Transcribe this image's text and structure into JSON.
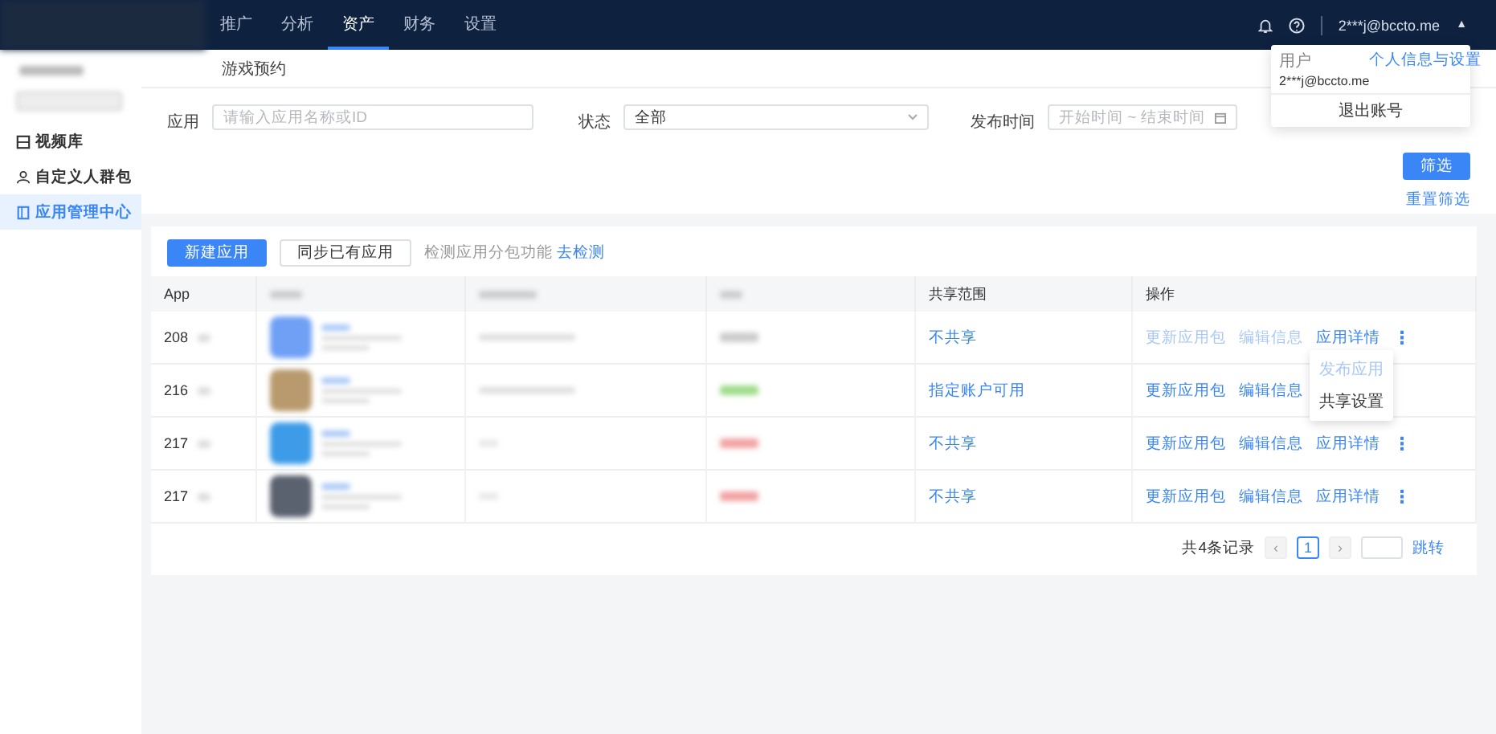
{
  "top_nav": {
    "items": [
      {
        "label": "推广",
        "selected": false
      },
      {
        "label": "分析",
        "selected": false
      },
      {
        "label": "资产",
        "selected": true
      },
      {
        "label": "财务",
        "selected": false
      },
      {
        "label": "设置",
        "selected": false
      }
    ],
    "account": "2***j@bccto.me",
    "account_caret": "▲"
  },
  "user_menu": {
    "role": "用户",
    "settings_link": "个人信息与设置",
    "email": "2***j@bccto.me",
    "logout": "退出账号"
  },
  "sidebar": {
    "items": [
      {
        "label": "视频库",
        "selected": false
      },
      {
        "label": "自定义人群包",
        "selected": false
      },
      {
        "label": "应用管理中心",
        "selected": true
      }
    ]
  },
  "page_title": "游戏预约",
  "filters": {
    "app_label": "应用",
    "app_placeholder": "请输入应用名称或ID",
    "status_label": "状态",
    "status_value": "全部",
    "time_label": "发布时间",
    "time_placeholder": "开始时间 ~ 结束时间",
    "filter_button": "筛选",
    "reset_link": "重置筛选"
  },
  "toolbar": {
    "new_button": "新建应用",
    "sync_button": "同步已有应用",
    "hint": "检测应用分包功能",
    "hint_link": "去检测"
  },
  "table": {
    "columns": [
      "App",
      "共享范围",
      "操作"
    ],
    "rows": [
      {
        "id": "208",
        "share": "不共享",
        "actions": [
          {
            "label": "更新应用包",
            "disabled": true
          },
          {
            "label": "编辑信息",
            "disabled": true
          },
          {
            "label": "应用详情",
            "disabled": false
          }
        ],
        "more": "⋮"
      },
      {
        "id": "216",
        "share": "指定账户可用",
        "actions": [
          {
            "label": "更新应用包",
            "disabled": false
          },
          {
            "label": "编辑信息",
            "disabled": false
          }
        ]
      },
      {
        "id": "217",
        "share": "不共享",
        "actions": [
          {
            "label": "更新应用包",
            "disabled": false
          },
          {
            "label": "编辑信息",
            "disabled": false
          },
          {
            "label": "应用详情",
            "disabled": false
          }
        ],
        "more": "⋮"
      },
      {
        "id": "217",
        "share": "不共享",
        "actions": [
          {
            "label": "更新应用包",
            "disabled": false
          },
          {
            "label": "编辑信息",
            "disabled": false
          },
          {
            "label": "应用详情",
            "disabled": false
          }
        ],
        "more": "⋮"
      }
    ]
  },
  "row_menu": {
    "items": [
      {
        "label": "发布应用",
        "disabled": true
      },
      {
        "label": "共享设置",
        "disabled": false
      }
    ]
  },
  "pagination": {
    "total": "共4条记录",
    "prev": "‹",
    "pages": [
      {
        "label": "1",
        "selected": true
      }
    ],
    "next": "›",
    "jump": "跳转"
  }
}
